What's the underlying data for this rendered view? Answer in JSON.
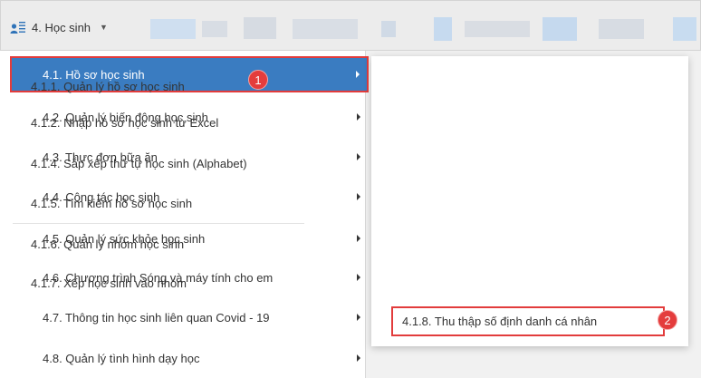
{
  "topbar": {
    "menu_label": "4. Học sinh",
    "user_icon": "user-list-icon",
    "caret_icon": "caret-down-icon"
  },
  "left_menu": {
    "items": [
      {
        "label": "4.1. Hồ sơ học sinh",
        "active": true
      },
      {
        "label": "4.2. Quản lý biến động học sinh"
      },
      {
        "label": "4.3. Thực đơn bữa ăn"
      },
      {
        "label": "4.4. Công tác học sinh"
      },
      {
        "label": "4.5. Quản lý sức khỏe học sinh"
      },
      {
        "label": "4.6. Chương trình Sóng và máy tính cho em"
      },
      {
        "label": "4.7. Thông tin học sinh liên quan Covid - 19"
      },
      {
        "label": "4.8. Quản lý tình hình dạy học"
      }
    ]
  },
  "sub_menu": {
    "items": [
      {
        "label": "4.1.1. Quản lý hồ sơ học sinh"
      },
      {
        "label": "4.1.2. Nhập hồ sơ học sinh từ Excel"
      },
      {
        "label": "4.1.4. Sắp xếp thứ tự học sinh (Alphabet)"
      },
      {
        "label": "4.1.5. Tìm kiếm hồ sơ học sinh"
      },
      {
        "label": "4.1.6. Quản lý nhóm học sinh"
      },
      {
        "label": "4.1.7. Xếp học sinh vào nhóm"
      },
      {
        "label": "4.1.8. Thu thập số định danh cá nhân",
        "highlighted": true
      }
    ]
  },
  "badges": {
    "step1": "1",
    "step2": "2"
  },
  "colors": {
    "active_bg": "#3a7cc1",
    "highlight_border": "#e23c3c",
    "badge": "#e43c3c"
  }
}
